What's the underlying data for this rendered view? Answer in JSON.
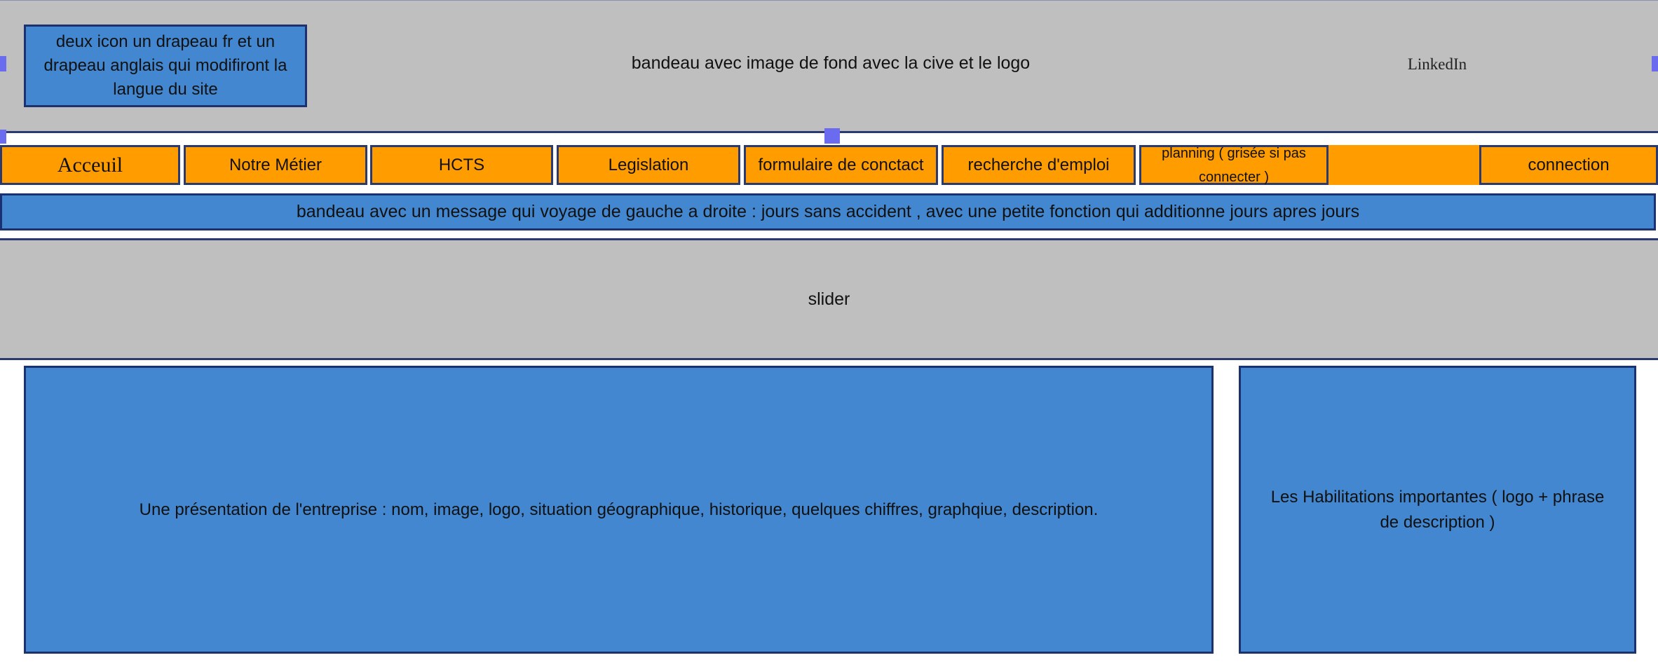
{
  "header": {
    "flags_text": "deux icon un drapeau fr et un drapeau anglais qui modifiront la langue du site",
    "title": "bandeau avec image de fond avec la cive et le logo",
    "linkedin": "LinkedIn"
  },
  "nav": {
    "items": [
      {
        "label": "Acceuil"
      },
      {
        "label": "Notre Métier"
      },
      {
        "label": "HCTS"
      },
      {
        "label": "Legislation"
      },
      {
        "label": "formulaire de conctact"
      },
      {
        "label": "recherche d'emploi"
      },
      {
        "label": "planning ( grisée si pas connecter )"
      },
      {
        "label": "connection"
      }
    ]
  },
  "ticker": {
    "text": "bandeau avec un message qui voyage de gauche a droite : jours sans accident , avec une petite fonction qui additionne jours apres jours"
  },
  "slider": {
    "label": "slider"
  },
  "main": {
    "presentation": "Une présentation de l'entreprise : nom, image, logo, situation géographique, historique, quelques chiffres, graphqiue, description.",
    "habilitations": "Les Habilitations importantes ( logo + phrase de description )"
  },
  "colors": {
    "blue": "#4287cf",
    "orange": "#ff9c00",
    "gray": "#bfbfbf",
    "border": "#1c3170"
  }
}
